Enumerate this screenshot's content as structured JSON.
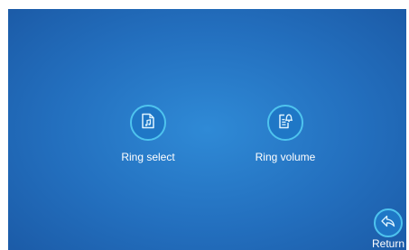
{
  "menu": {
    "items": [
      {
        "label": "Ring select",
        "icon": "music-file-icon"
      },
      {
        "label": "Ring volume",
        "icon": "bell-document-icon"
      }
    ]
  },
  "return_button": {
    "label": "Return",
    "icon": "return-arrow-icon"
  },
  "colors": {
    "background": "#236fbe",
    "accent_ring": "#4ec3ee",
    "text": "#ffffff"
  }
}
